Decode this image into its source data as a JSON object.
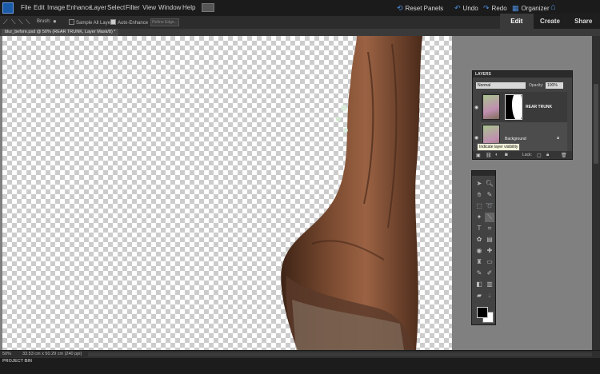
{
  "menu": [
    "File",
    "Edit",
    "Image",
    "Enhance",
    "Layer",
    "Select",
    "Filter",
    "View",
    "Window",
    "Help"
  ],
  "top_actions": {
    "reset_panels": "Reset Panels",
    "undo": "Undo",
    "redo": "Redo",
    "organizer": "Organizer"
  },
  "modes": {
    "edit": "Edit",
    "create": "Create",
    "share": "Share"
  },
  "options": {
    "brush": "Brush:",
    "sample_all": "Sample All Layers",
    "auto_enhance": "Auto-Enhance",
    "refine_edge": "Refine Edge..."
  },
  "document_tab": "blur_before.psd @ 50% (REAR TRUNK, Layer Mask/8) *",
  "status": {
    "zoom": "50%",
    "dims": "33.53 cm x 50.29 cm (240 ppi)"
  },
  "project_bin": "PROJECT BIN",
  "layers_panel": {
    "title": "LAYERS",
    "blend_mode": "Normal",
    "opacity_label": "Opacity:",
    "opacity": "100%",
    "lock_label": "Lock:",
    "layers": [
      {
        "name": "REAR TRUNK",
        "visible": true
      },
      {
        "name": "Background",
        "visible": true,
        "locked": true
      }
    ]
  },
  "tooltip": "Indicate layer visibility",
  "colors": {
    "accent": "#4d8fe0",
    "menubar": "#1b1b1b",
    "panel": "#424242"
  },
  "icons": {
    "home": "home-icon",
    "undo": "undo-icon",
    "redo": "redo-icon",
    "organizer": "organizer-icon",
    "reset_panels": "reset-panels-icon"
  }
}
